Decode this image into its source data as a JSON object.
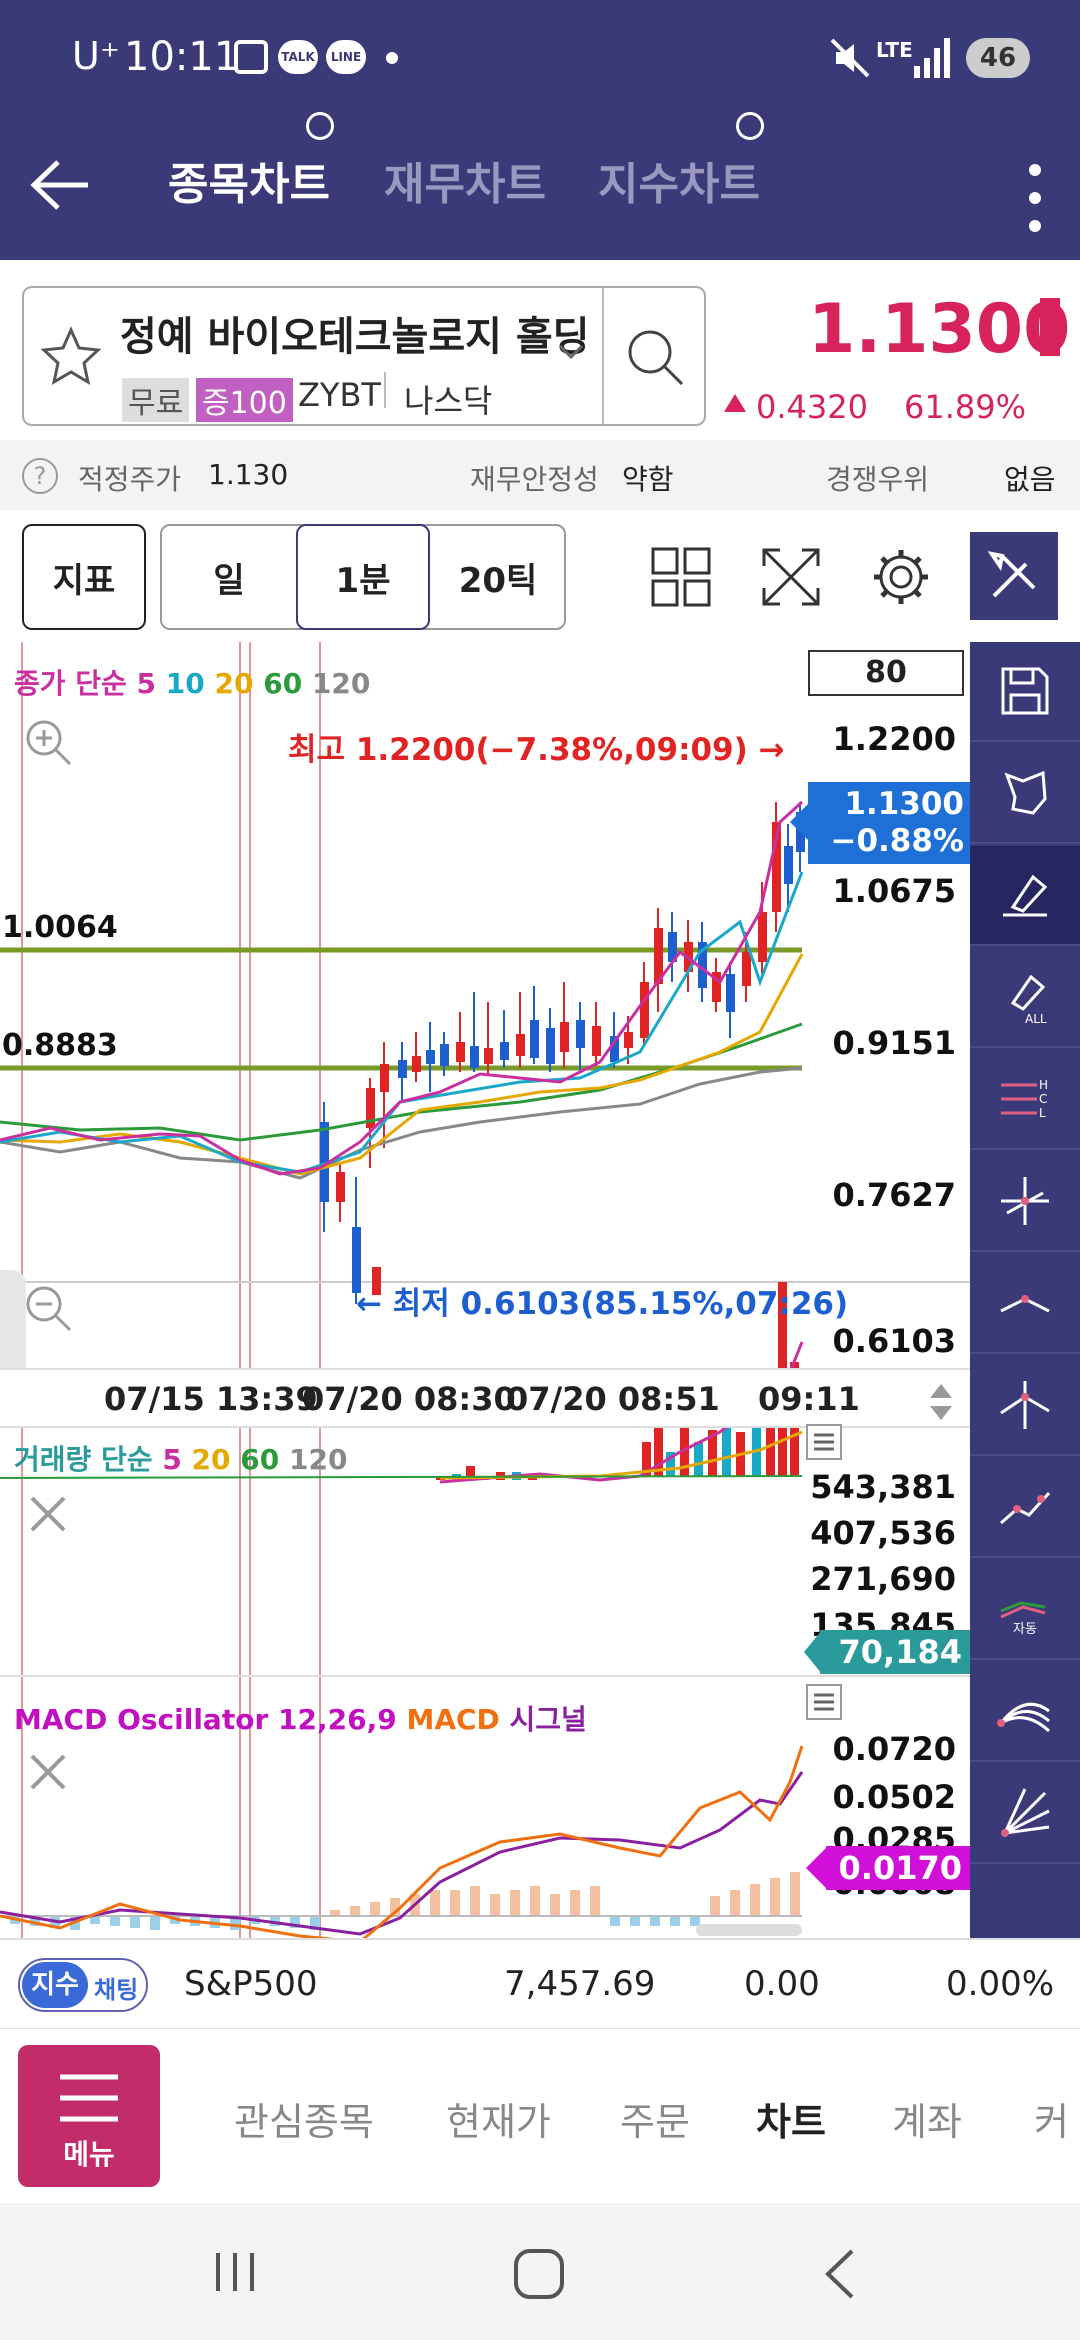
{
  "status_bar": {
    "carrier": "U⁺",
    "time": "10:11",
    "network": "LTE",
    "battery": "46"
  },
  "nav": {
    "tabs": [
      "종목차트",
      "재무차트",
      "지수차트"
    ],
    "active_tab": 0
  },
  "stock": {
    "name": "정예 바이오테크놀로지 홀딩",
    "badges": [
      "무료",
      "증100"
    ],
    "ticker": "ZYBT",
    "exchange": "나스닥",
    "price": "1.1300",
    "change": "0.4320",
    "change_pct": "61.89%"
  },
  "info": {
    "fair_price_label": "적정주가",
    "fair_price": "1.130",
    "stability_label": "재무안정성",
    "stability": "약함",
    "competitive_label": "경쟁우위",
    "competitive": "없음"
  },
  "toolbar": {
    "indicator": "지표",
    "day": "일",
    "minute": "1분",
    "tick": "20틱",
    "zoom_value": "80"
  },
  "price_chart": {
    "legend": {
      "prefix": "종가 단순",
      "ma5": "5",
      "ma10": "10",
      "ma20": "20",
      "ma60": "60",
      "ma120": "120"
    },
    "high_note": "최고 1.2200(−7.38%,09:09) →",
    "low_note": "← 최저 0.6103(85.15%,07:26)",
    "axis_labels": [
      "1.2200",
      "1.0675",
      "0.9151",
      "0.7627",
      "0.6103"
    ],
    "current_price": "1.1300",
    "current_change": "−0.88%",
    "line1_label": "1.0064",
    "line2_label": "0.8883",
    "time_labels": [
      "07/15 13:39",
      "07/20 08:30",
      "07/20 08:51",
      "09:11"
    ]
  },
  "volume_chart": {
    "legend": {
      "prefix": "거래량 단순",
      "ma5": "5",
      "ma20": "20",
      "ma60": "60",
      "ma120": "120"
    },
    "axis_labels": [
      "543,381",
      "407,536",
      "271,690",
      "135,845"
    ],
    "current": "70,184"
  },
  "macd_chart": {
    "legend": {
      "osc": "MACD Oscillator 12,26,9",
      "macd": "MACD",
      "signal": "시그널"
    },
    "axis_labels": [
      "0.0720",
      "0.0502",
      "0.0285",
      "0.0068"
    ],
    "current": "0.0170"
  },
  "chart_data": [
    {
      "type": "line",
      "title": "",
      "x": [
        "07/15 13:39",
        "07/20 08:30",
        "07/20 08:51",
        "09:11"
      ],
      "series": [
        {
          "name": "종가",
          "values": [
            0.78,
            0.61,
            0.89,
            1.13
          ]
        }
      ],
      "ylim": [
        0.6103,
        1.22
      ],
      "annotations": [
        "최고 1.2200(−7.38%,09:09)",
        "최저 0.6103(85.15%,07:26)"
      ],
      "grid": false,
      "legend": "top-left"
    }
  ],
  "index_bar": {
    "badge1": "지수",
    "badge2": "채팅",
    "name": "S&P500",
    "value": "7,457.69",
    "change": "0.00",
    "pct": "0.00%"
  },
  "bottom_nav": {
    "menu": "메뉴",
    "items": [
      "관심종목",
      "현재가",
      "주문",
      "차트",
      "계좌",
      "커"
    ],
    "active": "차트"
  },
  "colors": {
    "nav_bg": "#3a3a78",
    "up": "#d8235a",
    "up_candle": "#e02424",
    "down_candle": "#1e5fd0",
    "accent": "#3a3a78"
  }
}
